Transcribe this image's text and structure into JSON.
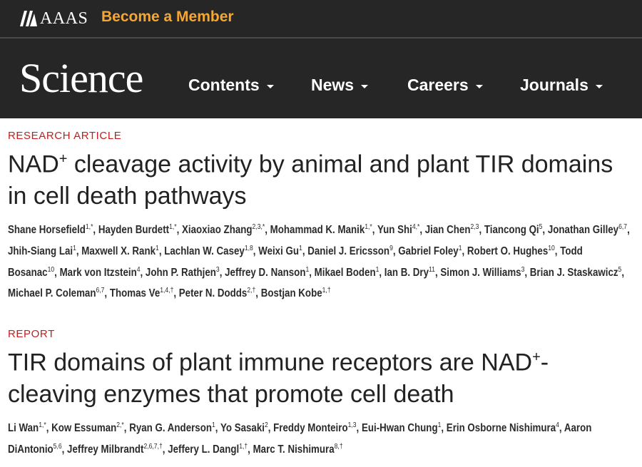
{
  "header": {
    "org_name": "AAAS",
    "member_link": "Become a Member"
  },
  "nav": {
    "logo": "Science",
    "items": [
      {
        "label": "Contents"
      },
      {
        "label": "News"
      },
      {
        "label": "Careers"
      },
      {
        "label": "Journals"
      }
    ]
  },
  "articles": [
    {
      "kind": "RESEARCH ARTICLE",
      "title_pre": "NAD",
      "title_sup": "+",
      "title_post": " cleavage activity by animal and plant TIR domains in cell death pathways",
      "authors": [
        {
          "name": "Shane Horsefield",
          "aff": "1,*"
        },
        {
          "name": "Hayden Burdett",
          "aff": "1,*"
        },
        {
          "name": "Xiaoxiao Zhang",
          "aff": "2,3,*"
        },
        {
          "name": "Mohammad K. Manik",
          "aff": "1,*"
        },
        {
          "name": "Yun Shi",
          "aff": "4,*"
        },
        {
          "name": "Jian Chen",
          "aff": "2,3"
        },
        {
          "name": "Tiancong Qi",
          "aff": "5"
        },
        {
          "name": "Jonathan Gilley",
          "aff": "6,7"
        },
        {
          "name": "Jhih-Siang Lai",
          "aff": "1"
        },
        {
          "name": "Maxwell X. Rank",
          "aff": "1"
        },
        {
          "name": "Lachlan W. Casey",
          "aff": "1,8"
        },
        {
          "name": "Weixi Gu",
          "aff": "1"
        },
        {
          "name": "Daniel J. Ericsson",
          "aff": "9"
        },
        {
          "name": "Gabriel Foley",
          "aff": "1"
        },
        {
          "name": "Robert O. Hughes",
          "aff": "10"
        },
        {
          "name": "Todd Bosanac",
          "aff": "10"
        },
        {
          "name": "Mark von Itzstein",
          "aff": "4"
        },
        {
          "name": "John P. Rathjen",
          "aff": "3"
        },
        {
          "name": "Jeffrey D. Nanson",
          "aff": "1"
        },
        {
          "name": "Mikael Boden",
          "aff": "1"
        },
        {
          "name": "Ian B. Dry",
          "aff": "11"
        },
        {
          "name": "Simon J. Williams",
          "aff": "3"
        },
        {
          "name": "Brian J. Staskawicz",
          "aff": "5"
        },
        {
          "name": "Michael P. Coleman",
          "aff": "6,7"
        },
        {
          "name": "Thomas Ve",
          "aff": "1,4,†"
        },
        {
          "name": "Peter N. Dodds",
          "aff": "2,†"
        },
        {
          "name": "Bostjan Kobe",
          "aff": "1,†"
        }
      ]
    },
    {
      "kind": "REPORT",
      "title_pre": "TIR domains of plant immune receptors are NAD",
      "title_sup": "+",
      "title_post": "-cleaving enzymes that promote cell death",
      "authors": [
        {
          "name": "Li Wan",
          "aff": "1,*"
        },
        {
          "name": "Kow Essuman",
          "aff": "2,*"
        },
        {
          "name": "Ryan G. Anderson",
          "aff": "1"
        },
        {
          "name": "Yo Sasaki",
          "aff": "2"
        },
        {
          "name": "Freddy Monteiro",
          "aff": "1,3"
        },
        {
          "name": "Eui-Hwan Chung",
          "aff": "1"
        },
        {
          "name": "Erin Osborne Nishimura",
          "aff": "4"
        },
        {
          "name": "Aaron DiAntonio",
          "aff": "5,6"
        },
        {
          "name": "Jeffrey Milbrandt",
          "aff": "2,6,7,†"
        },
        {
          "name": "Jeffery L. Dangl",
          "aff": "1,†"
        },
        {
          "name": "Marc T. Nishimura",
          "aff": "8,†"
        }
      ]
    }
  ]
}
